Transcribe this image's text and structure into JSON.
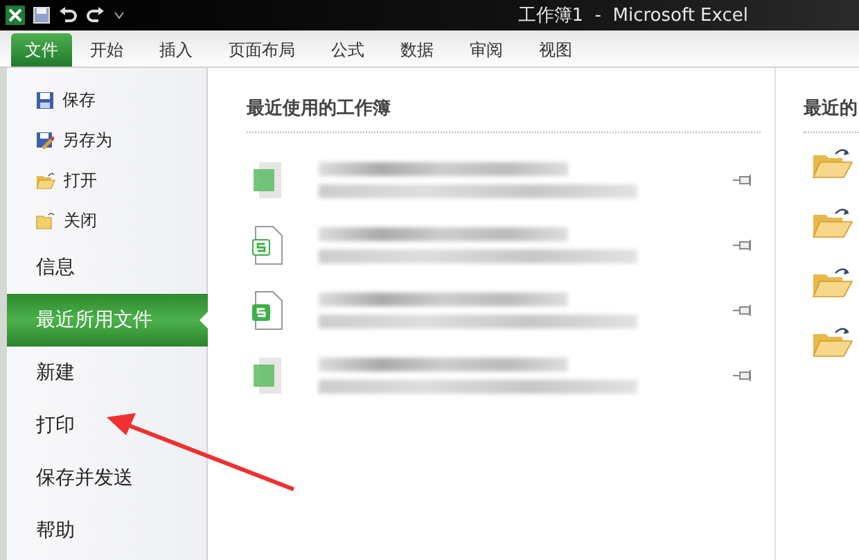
{
  "window": {
    "title": "工作簿1  -  Microsoft Excel"
  },
  "tabs": [
    {
      "label": "文件",
      "selected": true
    },
    {
      "label": "开始",
      "selected": false
    },
    {
      "label": "插入",
      "selected": false
    },
    {
      "label": "页面布局",
      "selected": false
    },
    {
      "label": "公式",
      "selected": false
    },
    {
      "label": "数据",
      "selected": false
    },
    {
      "label": "审阅",
      "selected": false
    },
    {
      "label": "视图",
      "selected": false
    }
  ],
  "menu": [
    {
      "kind": "command",
      "label": "保存",
      "selected": false
    },
    {
      "kind": "command",
      "label": "另存为",
      "selected": false
    },
    {
      "kind": "command",
      "label": "打开",
      "selected": false
    },
    {
      "kind": "command",
      "label": "关闭",
      "selected": false
    },
    {
      "kind": "section",
      "label": "信息",
      "selected": false
    },
    {
      "kind": "section",
      "label": "最近所用文件",
      "selected": true
    },
    {
      "kind": "section",
      "label": "新建",
      "selected": false
    },
    {
      "kind": "section",
      "label": "打印",
      "selected": false
    },
    {
      "kind": "section",
      "label": "保存并发送",
      "selected": false
    },
    {
      "kind": "section",
      "label": "帮助",
      "selected": false
    }
  ],
  "recent_workbooks": {
    "title": "最近使用的工作簿",
    "items": [
      {
        "kind": "blurred"
      },
      {
        "kind": "outline"
      },
      {
        "kind": "filled"
      },
      {
        "kind": "blurred"
      }
    ]
  },
  "recent_places": {
    "title": "最近的",
    "items": [
      {
        "kind": "folder"
      },
      {
        "kind": "folder"
      },
      {
        "kind": "folder"
      },
      {
        "kind": "folder"
      }
    ]
  }
}
